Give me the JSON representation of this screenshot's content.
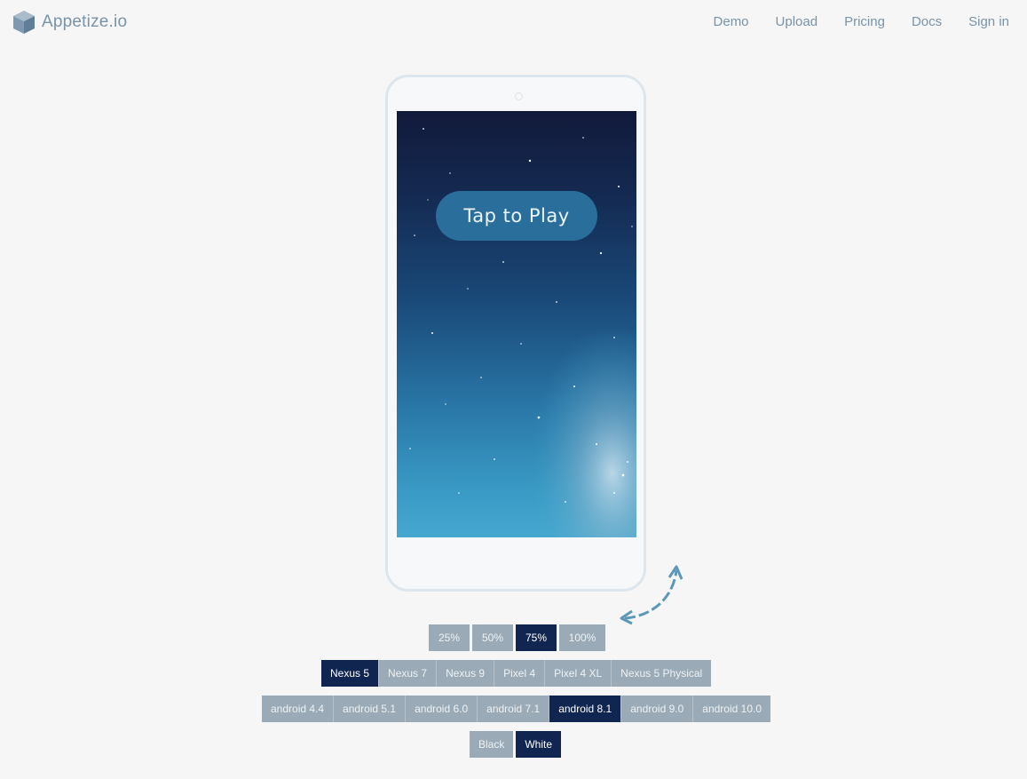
{
  "header": {
    "logo_text": "Appetize.io",
    "nav": [
      "Demo",
      "Upload",
      "Pricing",
      "Docs",
      "Sign in"
    ]
  },
  "screen": {
    "play_label": "Tap to Play"
  },
  "zoom": {
    "options": [
      "25%",
      "50%",
      "75%",
      "100%"
    ],
    "selected": "75%"
  },
  "devices": {
    "options": [
      "Nexus 5",
      "Nexus 7",
      "Nexus 9",
      "Pixel 4",
      "Pixel 4 XL",
      "Nexus 5 Physical"
    ],
    "selected": "Nexus 5"
  },
  "os_versions": {
    "options": [
      "android 4.4",
      "android 5.1",
      "android 6.0",
      "android 7.1",
      "android 8.1",
      "android 9.0",
      "android 10.0"
    ],
    "selected": "android 8.1"
  },
  "device_color": {
    "options": [
      "Black",
      "White"
    ],
    "selected": "White"
  },
  "colors": {
    "accent_dark": "#112551",
    "option_gray": "#9aabb7",
    "nav_text": "#7a93a6"
  },
  "icons": [
    "cube-logo-icon",
    "rotate-device-icon"
  ]
}
